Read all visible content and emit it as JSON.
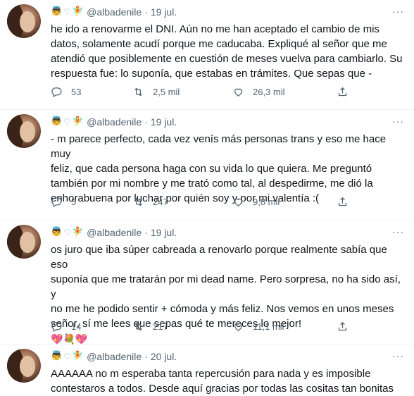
{
  "tweets": [
    {
      "author_emojis": [
        "👼",
        "♡",
        "🧚"
      ],
      "handle": "@albadenile",
      "date": "19 jul.",
      "lines": [
        "he ido a renovarme el DNI. Aún no me han aceptado el cambio de mis",
        "datos, solamente acudí porque me caducaba. Expliqué al señor que me",
        "atendió que posiblemente en cuestión de meses vuelva para cambiarlo. Su",
        "respuesta fue: lo suponía, que estabas en trámites. Que sepas que -"
      ],
      "replies": "53",
      "retweets": "2,5 mil",
      "likes": "26,3 mil"
    },
    {
      "author_emojis": [
        "👼",
        "♡",
        "🧚"
      ],
      "handle": "@albadenile",
      "date": "19 jul.",
      "lines": [
        "- m parece perfecto, cada vez venís más personas trans y eso me hace muy",
        "feliz, que cada persona haga con su vida lo que quiera. Me preguntó",
        "también por mi nombre y me trató como tal, al despedirme, me dió la",
        "enhorabuena por luchar por quién soy y por mi valentía :("
      ],
      "replies": "5",
      "retweets": "247",
      "likes": "9,8 mil"
    },
    {
      "author_emojis": [
        "👼",
        "♡",
        "🧚"
      ],
      "handle": "@albadenile",
      "date": "19 jul.",
      "lines": [
        "os juro que iba súper cabreada a renovarlo porque realmente sabía que eso",
        "suponía que me tratarán por mi dead name. Pero sorpresa, no ha sido así, y",
        "no me he podido sentir + cómoda y más feliz. Nos vemos en unos meses",
        "señor, sí me lees que sepas qué te mereces lo mejor!"
      ],
      "emoji_line": [
        "💖",
        "💐",
        "💖"
      ],
      "replies": "14",
      "retweets": "217",
      "likes": "11,1 mil"
    },
    {
      "author_emojis": [
        "👼",
        "♡",
        "🧚"
      ],
      "handle": "@albadenile",
      "date": "20 jul.",
      "lines": [
        "AAAAAA no m esperaba tanta repercusión para nada y es imposible",
        "contestaros a todos. Desde aquí gracias por todas las cositas tan bonitas"
      ]
    }
  ],
  "more_label": "···",
  "separator": "·"
}
